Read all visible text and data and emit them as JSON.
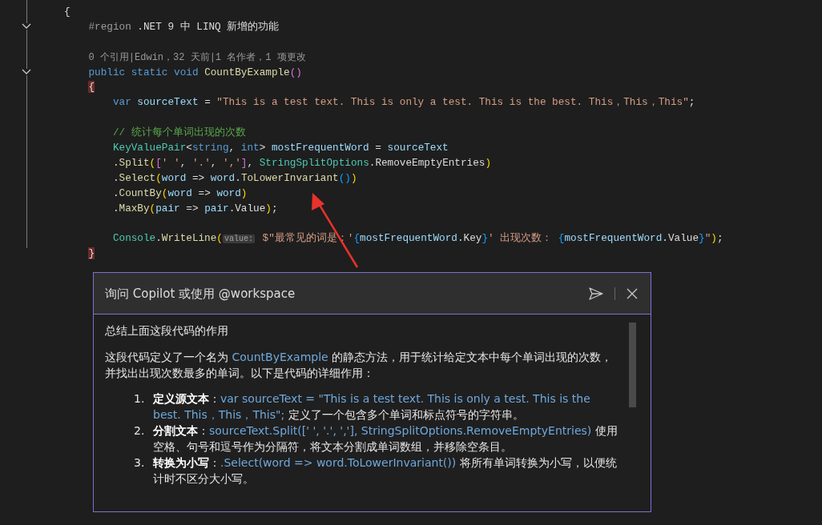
{
  "editor": {
    "lines": [
      {
        "kind": "code",
        "tokens": [
          {
            "text": "{",
            "kind": "plain"
          }
        ],
        "children": [
          {
            "kind": "code",
            "fold": true,
            "tokens": [
              {
                "text": "#region",
                "kind": "region"
              },
              {
                "text": " .NET 9 中 LINQ 新增的功能",
                "kind": "plain"
              }
            ]
          },
          {
            "kind": "blank"
          },
          {
            "kind": "code",
            "tokens": [
              {
                "text": "0 个引用|Edwin，32 天前|1 名作者，1 项更改",
                "kind": "codelens"
              }
            ]
          },
          {
            "kind": "code",
            "fold": true,
            "tokens": [
              {
                "text": "public static void ",
                "kind": "keyword"
              },
              {
                "text": "CountByExample",
                "kind": "method"
              },
              {
                "text": "()",
                "kind": "paren2"
              }
            ]
          },
          {
            "kind": "code",
            "tokens": [
              {
                "text": "{",
                "kind": "brace-match"
              }
            ],
            "children": [
              {
                "kind": "code",
                "tokens": [
                  {
                    "text": "var",
                    "kind": "keyword"
                  },
                  {
                    "text": " sourceText",
                    "kind": "variable"
                  },
                  {
                    "text": " = ",
                    "kind": "plain"
                  },
                  {
                    "text": "\"This is a test text. This is only a test. This is the best. This，This，This\"",
                    "kind": "string"
                  },
                  {
                    "text": ";",
                    "kind": "plain"
                  }
                ]
              },
              {
                "kind": "blank"
              },
              {
                "kind": "code",
                "tokens": [
                  {
                    "text": "// 统计每个单词出现的次数",
                    "kind": "comment"
                  }
                ]
              },
              {
                "kind": "code",
                "tokens": [
                  {
                    "text": "KeyValuePair",
                    "kind": "type"
                  },
                  {
                    "text": "<",
                    "kind": "plain"
                  },
                  {
                    "text": "string",
                    "kind": "keyword"
                  },
                  {
                    "text": ", ",
                    "kind": "plain"
                  },
                  {
                    "text": "int",
                    "kind": "keyword"
                  },
                  {
                    "text": "> ",
                    "kind": "plain"
                  },
                  {
                    "text": "mostFrequentWord",
                    "kind": "variable"
                  },
                  {
                    "text": " = ",
                    "kind": "plain"
                  },
                  {
                    "text": "sourceText",
                    "kind": "variable"
                  }
                ]
              },
              {
                "kind": "code",
                "tokens": [
                  {
                    "text": ".",
                    "kind": "plain"
                  },
                  {
                    "text": "Split",
                    "kind": "method"
                  },
                  {
                    "text": "(",
                    "kind": "paren1"
                  },
                  {
                    "text": "[",
                    "kind": "paren2"
                  },
                  {
                    "text": "' '",
                    "kind": "string"
                  },
                  {
                    "text": ", ",
                    "kind": "plain"
                  },
                  {
                    "text": "'.'",
                    "kind": "string"
                  },
                  {
                    "text": ", ",
                    "kind": "plain"
                  },
                  {
                    "text": "','",
                    "kind": "string"
                  },
                  {
                    "text": "]",
                    "kind": "paren2"
                  },
                  {
                    "text": ", ",
                    "kind": "plain"
                  },
                  {
                    "text": "StringSplitOptions",
                    "kind": "type"
                  },
                  {
                    "text": ".RemoveEmptyEntries",
                    "kind": "plain"
                  },
                  {
                    "text": ")",
                    "kind": "paren1"
                  }
                ]
              },
              {
                "kind": "code",
                "tokens": [
                  {
                    "text": ".",
                    "kind": "plain"
                  },
                  {
                    "text": "Select",
                    "kind": "method"
                  },
                  {
                    "text": "(",
                    "kind": "paren1"
                  },
                  {
                    "text": "word",
                    "kind": "variable"
                  },
                  {
                    "text": " => ",
                    "kind": "plain"
                  },
                  {
                    "text": "word",
                    "kind": "variable"
                  },
                  {
                    "text": ".",
                    "kind": "plain"
                  },
                  {
                    "text": "ToLowerInvariant",
                    "kind": "method"
                  },
                  {
                    "text": "()",
                    "kind": "paren3"
                  },
                  {
                    "text": ")",
                    "kind": "paren1"
                  }
                ]
              },
              {
                "kind": "code",
                "tokens": [
                  {
                    "text": ".",
                    "kind": "plain"
                  },
                  {
                    "text": "CountBy",
                    "kind": "method"
                  },
                  {
                    "text": "(",
                    "kind": "paren1"
                  },
                  {
                    "text": "word",
                    "kind": "variable"
                  },
                  {
                    "text": " => ",
                    "kind": "plain"
                  },
                  {
                    "text": "word",
                    "kind": "variable"
                  },
                  {
                    "text": ")",
                    "kind": "paren1"
                  }
                ]
              },
              {
                "kind": "code",
                "tokens": [
                  {
                    "text": ".",
                    "kind": "plain"
                  },
                  {
                    "text": "MaxBy",
                    "kind": "method"
                  },
                  {
                    "text": "(",
                    "kind": "paren1"
                  },
                  {
                    "text": "pair",
                    "kind": "variable"
                  },
                  {
                    "text": " => ",
                    "kind": "plain"
                  },
                  {
                    "text": "pair",
                    "kind": "variable"
                  },
                  {
                    "text": ".Value",
                    "kind": "plain"
                  },
                  {
                    "text": ")",
                    "kind": "paren1"
                  },
                  {
                    "text": ";",
                    "kind": "plain"
                  }
                ]
              },
              {
                "kind": "blank"
              },
              {
                "kind": "code",
                "tokens": [
                  {
                    "text": "Console",
                    "kind": "type"
                  },
                  {
                    "text": ".",
                    "kind": "plain"
                  },
                  {
                    "text": "WriteLine",
                    "kind": "method"
                  },
                  {
                    "text": "(",
                    "kind": "paren1"
                  },
                  {
                    "text": "value:",
                    "kind": "hint"
                  },
                  {
                    "text": " $\"最常见的词是：'",
                    "kind": "string"
                  },
                  {
                    "text": "{",
                    "kind": "paren3"
                  },
                  {
                    "text": "mostFrequentWord",
                    "kind": "variable"
                  },
                  {
                    "text": ".Key",
                    "kind": "plain"
                  },
                  {
                    "text": "}",
                    "kind": "paren3"
                  },
                  {
                    "text": "' 出现次数： ",
                    "kind": "string"
                  },
                  {
                    "text": "{",
                    "kind": "paren3"
                  },
                  {
                    "text": "mostFrequentWord",
                    "kind": "variable"
                  },
                  {
                    "text": ".Value",
                    "kind": "plain"
                  },
                  {
                    "text": "}",
                    "kind": "paren3"
                  },
                  {
                    "text": "\"",
                    "kind": "string"
                  },
                  {
                    "text": ")",
                    "kind": "paren1"
                  },
                  {
                    "text": ";",
                    "kind": "plain"
                  }
                ]
              }
            ]
          },
          {
            "kind": "code",
            "tokens": [
              {
                "text": "}",
                "kind": "brace-match"
              }
            ]
          }
        ]
      }
    ]
  },
  "copilot": {
    "placeholder": "询问 Copilot 或使用 @workspace",
    "prompt": "总结上面这段代码的作用",
    "intro": [
      {
        "text": "这段代码定义了一个名为 ",
        "kind": "plain"
      },
      {
        "text": "CountByExample",
        "kind": "code"
      },
      {
        "text": " 的静态方法，用于统计给定文本中每个单词出现的次数，并找出出现次数最多的单词。以下是代码的详细作用：",
        "kind": "plain"
      }
    ],
    "steps": [
      {
        "number": "1.",
        "parts": [
          {
            "text": "定义源文本",
            "kind": "bold"
          },
          {
            "text": "：",
            "kind": "plain"
          },
          {
            "text": "var sourceText = \"This is a test text. This is only a test. This is the best. This，This，This\";",
            "kind": "code"
          },
          {
            "text": " 定义了一个包含多个单词和标点符号的字符串。",
            "kind": "plain"
          }
        ]
      },
      {
        "number": "2.",
        "parts": [
          {
            "text": "分割文本",
            "kind": "bold"
          },
          {
            "text": "：",
            "kind": "plain"
          },
          {
            "text": "sourceText.Split([' ', '.', ','], StringSplitOptions.RemoveEmptyEntries)",
            "kind": "code"
          },
          {
            "text": " 使用空格、句号和逗号作为分隔符，将文本分割成单词数组，并移除空条目。",
            "kind": "plain"
          }
        ]
      },
      {
        "number": "3.",
        "parts": [
          {
            "text": "转换为小写",
            "kind": "bold"
          },
          {
            "text": "：",
            "kind": "plain"
          },
          {
            "text": ".Select(word => word.ToLowerInvariant())",
            "kind": "code"
          },
          {
            "text": " 将所有单词转换为小写，以便统计时不区分大小写。",
            "kind": "plain"
          }
        ]
      }
    ]
  }
}
